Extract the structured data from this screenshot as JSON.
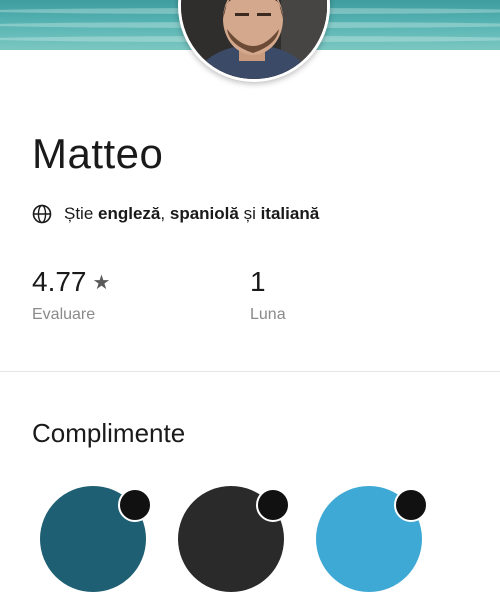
{
  "profile": {
    "name": "Matteo",
    "languages": {
      "prefix": "Știe",
      "lang1": "engleză",
      "sep1": ",",
      "lang2": "spaniolă",
      "sep2": "și",
      "lang3": "italiană"
    }
  },
  "stats": [
    {
      "value": "4.77",
      "label": "Evaluare",
      "icon": "star-icon"
    },
    {
      "value": "1",
      "label": "Luna"
    }
  ],
  "compliments": {
    "title": "Complimente",
    "badge_colors": [
      "#1f5f73",
      "#2a2a2a",
      "#3fa9d6"
    ]
  },
  "colors": {
    "banner": "#4fb0ad",
    "star": "#5a5a5a",
    "muted": "#8a8a8a"
  }
}
